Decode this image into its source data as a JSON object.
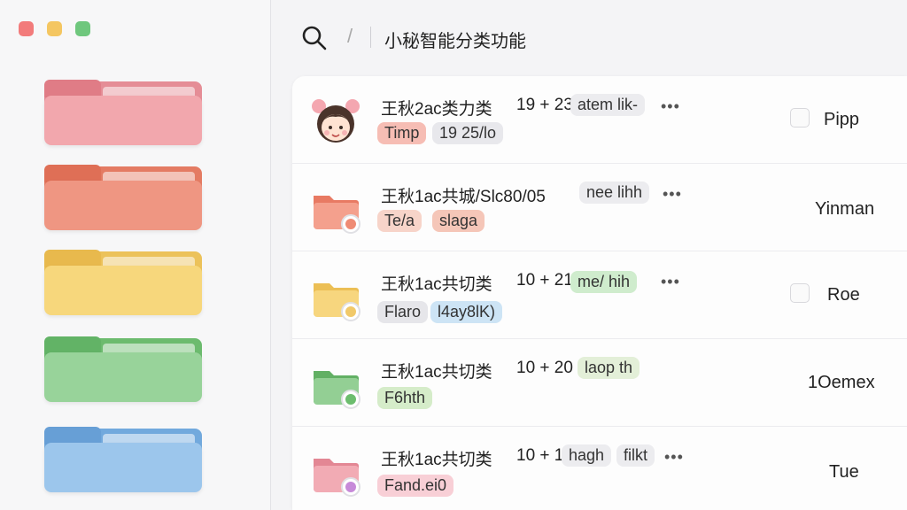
{
  "window": {
    "controls": [
      "close",
      "minimize",
      "maximize"
    ]
  },
  "sidebar": {
    "folders": [
      {
        "color": "#f09aa2",
        "icon": "folder-icon"
      },
      {
        "color": "#ee8b75",
        "icon": "folder-icon"
      },
      {
        "color": "#f6d26f",
        "icon": "folder-icon"
      },
      {
        "color": "#86c986",
        "icon": "folder-icon"
      },
      {
        "color": "#8dbbe6",
        "icon": "folder-icon"
      }
    ]
  },
  "header": {
    "separator": "/",
    "title": "小秘智能分类功能"
  },
  "rows": [
    {
      "name": "王秋2ac类力类",
      "meta": "19 + 23",
      "tag": "atem lik-",
      "more": "•••",
      "chip1": "Timp",
      "chip2": "19 25/lo",
      "assignee": "Pipp",
      "has_checkbox": true,
      "icon": "avatar-girl-icon"
    },
    {
      "name": "王秋1ac共城/Slc80/05",
      "meta": "",
      "tag": "nee lihh",
      "more": "•••",
      "chip1": "Te/a",
      "chip2": "slaga",
      "assignee": "Yinman",
      "has_checkbox": false,
      "icon": "folder-icon"
    },
    {
      "name": "王秋1ac共切类",
      "meta": "10 + 21",
      "tag": "me/ hih",
      "more": "•••",
      "chip1": "Flaro",
      "chip2": "l4ay8lK)",
      "assignee": "Roe",
      "has_checkbox": true,
      "icon": "folder-icon"
    },
    {
      "name": "王秋1ac共切类",
      "meta": "10 + 20",
      "tag": "laop th",
      "more": "",
      "chip1": "F6hth",
      "chip2": "",
      "assignee": "1Oemex",
      "has_checkbox": false,
      "icon": "folder-icon"
    },
    {
      "name": "王秋1ac共切类",
      "meta": "10 + 1",
      "tag": "hagh",
      "tag2": "filkt",
      "more": "•••",
      "chip1": "Fand.ei0",
      "chip2": "",
      "assignee": "Tue",
      "has_checkbox": false,
      "icon": "folder-icon"
    }
  ]
}
